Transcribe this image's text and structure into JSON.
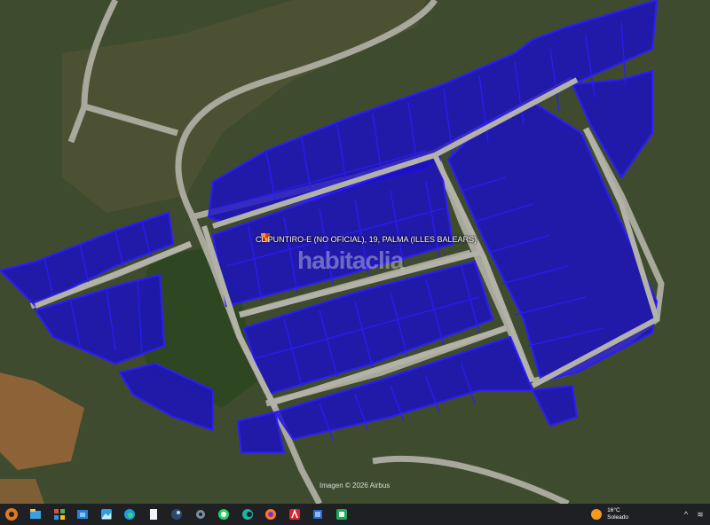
{
  "map": {
    "parcel_label": "CL PUNTIRO-E (NO OFICIAL), 19, PALMA (ILLES BALEARS)",
    "watermark": "habitaclia",
    "attribution": "Imagen © 2026 Airbus",
    "colors": {
      "parcel_fill": "#1b10c4",
      "parcel_stroke": "#2a1cff",
      "road": "#a7a79b",
      "vegetation": "#3b4a2b"
    }
  },
  "taskbar": {
    "apps": [
      "start-icon",
      "file-manager-icon",
      "windows-icon",
      "store-icon",
      "photos-icon",
      "edge-icon",
      "file-icon",
      "steam-icon",
      "settings-icon",
      "whatsapp-icon",
      "browser-icon",
      "firefox-icon",
      "acrobat-icon",
      "app-icon",
      "sheet-icon"
    ],
    "temperature": "16°C",
    "weather": "Soleado"
  }
}
